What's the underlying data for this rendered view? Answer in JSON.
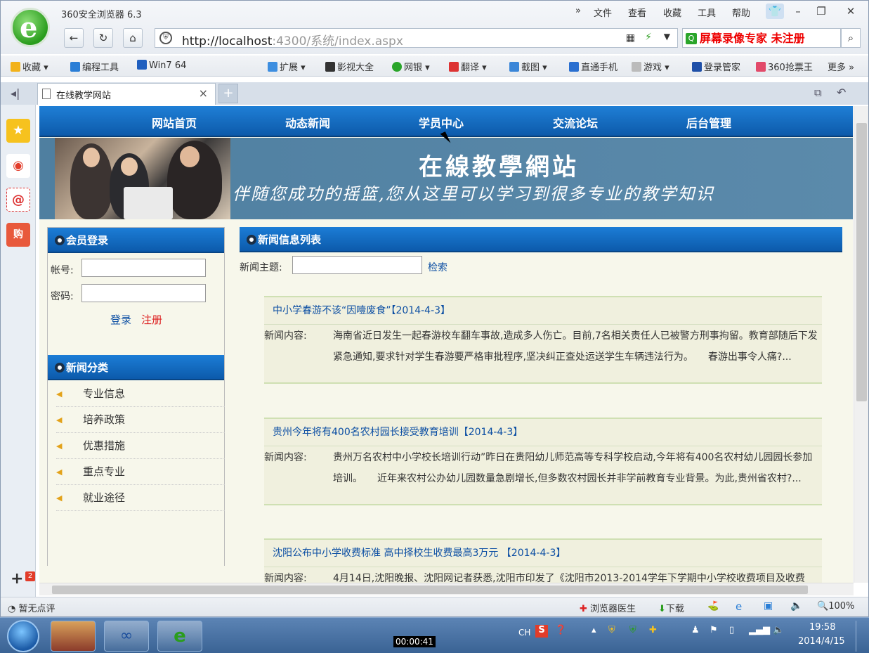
{
  "browser": {
    "app_title": "360安全浏览器 6.3",
    "menu": [
      "»",
      "文件",
      "查看",
      "收藏",
      "工具",
      "帮助"
    ],
    "url_host": "http://localhost",
    "url_rest": ":4300/系统/index.aspx",
    "search_watermark": "屏幕录像专家 未注册",
    "favorites": [
      "收藏",
      "编程工具",
      "Win7 64",
      "扩展",
      "影视大全",
      "网银",
      "翻译",
      "截图",
      "直通手机",
      "游戏",
      "登录管家",
      "360抢票王",
      "更多"
    ],
    "tab_title": "在线教学网站",
    "status_left": "暂无点评",
    "status_right": [
      "浏览器医生",
      "下载",
      "100%"
    ],
    "badge": "2"
  },
  "site": {
    "nav": [
      "网站首页",
      "动态新闻",
      "学员中心",
      "交流论坛",
      "后台管理"
    ],
    "banner_title": "在線教學網站",
    "banner_sub": "伴随您成功的摇篮,您从这里可以学习到很多专业的教学知识",
    "login": {
      "title": "会员登录",
      "account_label": "帐号:",
      "password_label": "密码:",
      "login_link": "登录",
      "register_link": "注册"
    },
    "categories": {
      "title": "新闻分类",
      "items": [
        "专业信息",
        "培养政策",
        "优惠措施",
        "重点专业",
        "就业途径"
      ]
    },
    "news": {
      "title": "新闻信息列表",
      "search_label": "新闻主题:",
      "search_button": "检索",
      "content_label": "新闻内容:",
      "items": [
        {
          "title": "中小学春游不该“因噎废食”【2014-4-3】",
          "body": "海南省近日发生一起春游校车翻车事故,造成多人伤亡。目前,7名相关责任人已被警方刑事拘留。教育部随后下发紧急通知,要求针对学生春游要严格审批程序,坚决纠正查处运送学生车辆违法行为。　　春游出事令人痛?..."
        },
        {
          "title": "贵州今年将有400名农村园长接受教育培训【2014-4-3】",
          "body": "贵州万名农村中小学校长培训行动”昨日在贵阳幼儿师范高等专科学校启动,今年将有400名农村幼儿园园长参加培训。　　近年来农村公办幼儿园数量急剧增长,但多数农村园长并非学前教育专业背景。为此,贵州省农村?..."
        },
        {
          "title": "沈阳公布中小学收费标准 高中择校生收费最高3万元 【2014-4-3】",
          "body": "4月14日,沈阳晚报、沈阳网记者获悉,沈阳市印发了《沈阳市2013-2014学年下学期中小学校收费项目及收费"
        }
      ]
    }
  },
  "taskbar": {
    "recording_time": "00:00:41",
    "lang": "CH",
    "clock_time": "19:58",
    "clock_date": "2014/4/15"
  }
}
